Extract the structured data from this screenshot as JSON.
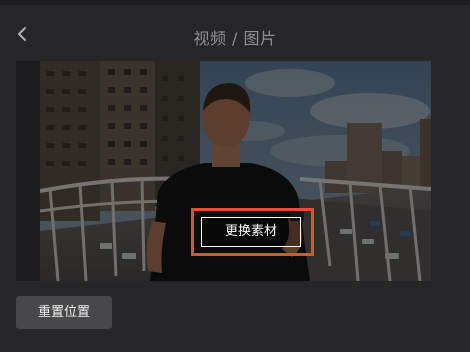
{
  "header": {
    "back_icon": "chevron-left-icon",
    "title": "视频 / 图片"
  },
  "preview": {
    "replace_label": "更换素材"
  },
  "footer": {
    "reset_label": "重置位置"
  },
  "colors": {
    "background": "#262628",
    "highlight": "#e4502f",
    "reset_button": "#48484a"
  }
}
